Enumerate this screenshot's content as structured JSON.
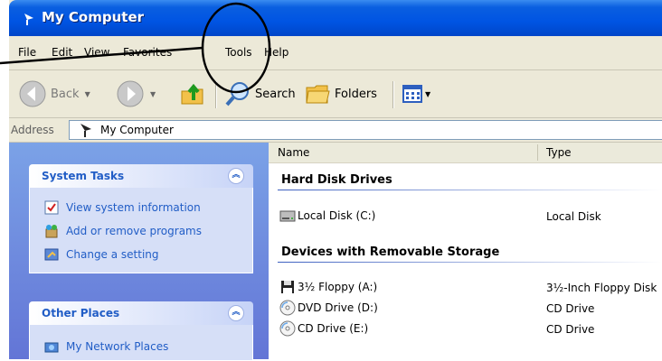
{
  "window": {
    "title": "My Computer"
  },
  "menu": [
    "File",
    "Edit",
    "View",
    "Favorites",
    "Tools",
    "Help"
  ],
  "toolbar": {
    "back": "Back",
    "search": "Search",
    "folders": "Folders"
  },
  "address": {
    "label": "Address",
    "value": "My Computer"
  },
  "system_tasks": {
    "title": "System Tasks",
    "items": [
      "View system information",
      "Add or remove programs",
      "Change a setting"
    ]
  },
  "other_places": {
    "title": "Other Places",
    "items": [
      "My Network Places"
    ]
  },
  "columns": {
    "name": "Name",
    "type": "Type"
  },
  "groups": {
    "hard_disk": {
      "title": "Hard Disk Drives",
      "items": [
        {
          "name": "Local Disk (C:)",
          "type": "Local Disk"
        }
      ]
    },
    "removable": {
      "title": "Devices with Removable Storage",
      "items": [
        {
          "name": "3½ Floppy (A:)",
          "type": "3½-Inch Floppy Disk"
        },
        {
          "name": "DVD Drive (D:)",
          "type": "CD Drive"
        },
        {
          "name": "CD Drive (E:)",
          "type": "CD Drive"
        }
      ]
    }
  },
  "colors": {
    "titlebar": "#0054e3",
    "taskpane": "#6f8ddd",
    "link": "#215dc6",
    "annotation": "#000000"
  }
}
